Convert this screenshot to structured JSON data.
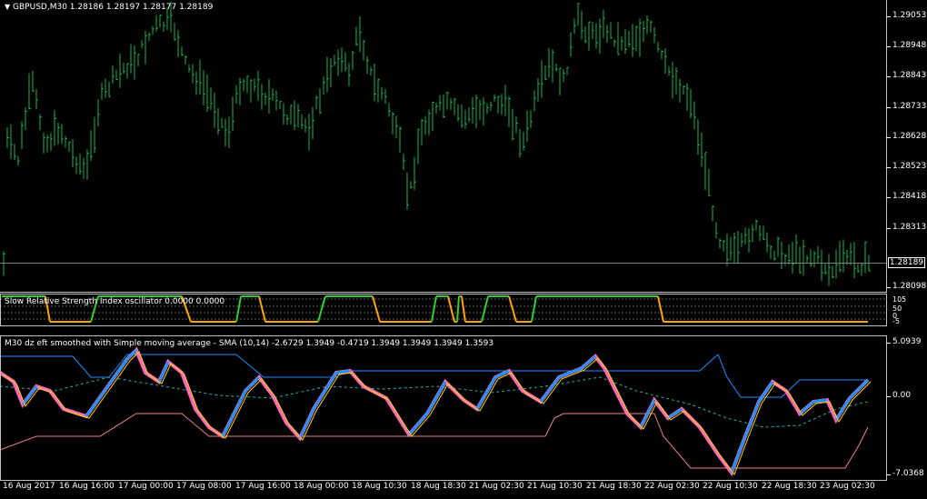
{
  "symbol_header": {
    "symbol": "GBPUSD,M30",
    "open": "1.28186",
    "high": "1.28197",
    "low": "1.28177",
    "close": "1.28189"
  },
  "main_axis": {
    "labels": [
      "1.29053",
      "1.28948",
      "1.28843",
      "1.28733",
      "1.28628",
      "1.28523",
      "1.28418",
      "1.28313",
      "1.28189",
      "1.28098"
    ],
    "current_price": "1.28189"
  },
  "rsi_panel": {
    "title": "Slow Relative Strength Index oscillator 0.0000 0.0000",
    "axis_labels": [
      "105",
      "50",
      "0",
      "-5"
    ]
  },
  "dz_panel": {
    "title": "M30 dz eft smoothed with Simple moving average - SMA (10,14) -2.6729 1.3949 -0.4719 1.3949 1.3949 1.3949 1.3593",
    "axis_labels": [
      "5.0939",
      "0.00",
      "-7.0368"
    ]
  },
  "time_axis": {
    "labels": [
      "16 Aug 2017",
      "16 Aug 16:00",
      "17 Aug 00:00",
      "17 Aug 08:00",
      "17 Aug 16:00",
      "18 Aug 00:00",
      "18 Aug 10:30",
      "18 Aug 18:30",
      "21 Aug 02:30",
      "21 Aug 10:30",
      "21 Aug 18:30",
      "22 Aug 02:30",
      "22 Aug 10:30",
      "22 Aug 18:30",
      "23 Aug 02:30"
    ]
  },
  "colors": {
    "bars": "#22b14c",
    "rsi_up": "#32cd32",
    "rsi_down": "#ffa500",
    "blue_line": "#1e90ff",
    "pink_line": "#ff69b4",
    "band_upper": "#1e90ff",
    "band_lower": "#f08080",
    "mid_dotted": "#20b2aa"
  }
}
